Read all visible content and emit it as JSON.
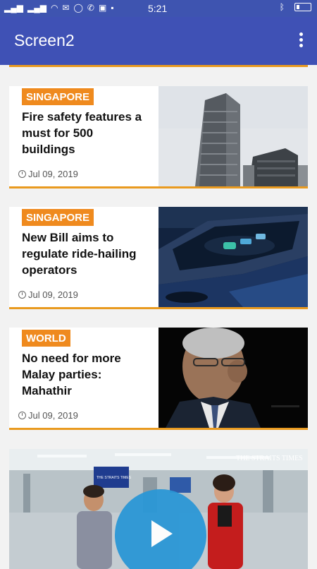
{
  "status_bar": {
    "time": "5:21",
    "left_icons": [
      "signal-icon",
      "signal-icon",
      "wifi-icon",
      "mail-icon",
      "whatsapp-icon",
      "phone-icon",
      "camera-icon",
      "facebook-icon"
    ],
    "right_icons": [
      "bluetooth-icon",
      "battery-icon"
    ]
  },
  "app_bar": {
    "title": "Screen2",
    "menu_icon": "overflow-menu-icon"
  },
  "articles": [
    {
      "category": "SINGAPORE",
      "headline": "Fire safety features a must for 500 buildings",
      "date": "Jul 09, 2019",
      "image": "building-photo"
    },
    {
      "category": "SINGAPORE",
      "headline": "New Bill aims to regulate ride-hailing operators",
      "date": "Jul 09, 2019",
      "image": "car-photo"
    },
    {
      "category": "WORLD",
      "headline": "No need for more Malay parties: Mahathir",
      "date": "Jul 09, 2019",
      "image": "portrait-photo"
    }
  ],
  "video": {
    "watermark": "THE STRAITS TIMES",
    "screen_text": "THE STRAITS TIMES",
    "play_icon": "play-icon"
  },
  "colors": {
    "app_bar": "#3f51b5",
    "accent": "#e99a1f",
    "badge": "#ef8a1e",
    "play": "#2b97d6"
  }
}
